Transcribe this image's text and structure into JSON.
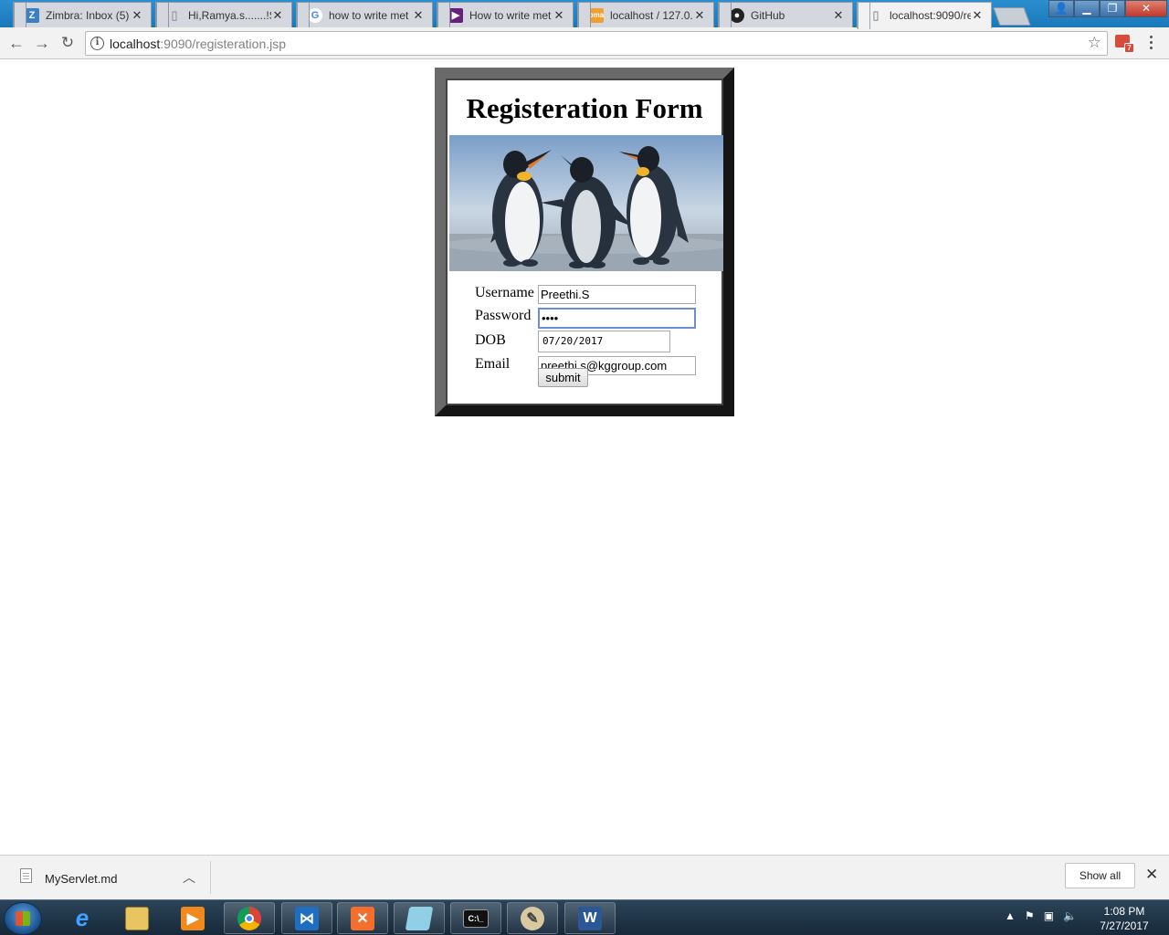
{
  "browser": {
    "tabs": [
      {
        "title": "Zimbra: Inbox (5)",
        "active": false
      },
      {
        "title": "Hi,Ramya.s.......!Se",
        "active": false
      },
      {
        "title": "how to write met",
        "active": false
      },
      {
        "title": "How to write met",
        "active": false
      },
      {
        "title": "localhost / 127.0.",
        "active": false
      },
      {
        "title": "GitHub",
        "active": false
      },
      {
        "title": "localhost:9090/re",
        "active": true
      }
    ],
    "address": {
      "host": "localhost",
      "path": ":9090/registeration.jsp"
    },
    "extension_badge": "7"
  },
  "page": {
    "title": "Registeration Form",
    "fields": {
      "username": {
        "label": "Username",
        "value": "Preethi.S"
      },
      "password": {
        "label": "Password",
        "value": "••••"
      },
      "dob": {
        "label": "DOB",
        "value": "07/20/2017"
      },
      "email": {
        "label": "Email",
        "value": "preethi.s@kggroup.com"
      }
    },
    "submit_label": "submit"
  },
  "downloads": {
    "file_name": "MyServlet.md",
    "show_all_label": "Show all"
  },
  "taskbar": {
    "time": "1:08 PM",
    "date": "7/27/2017"
  }
}
